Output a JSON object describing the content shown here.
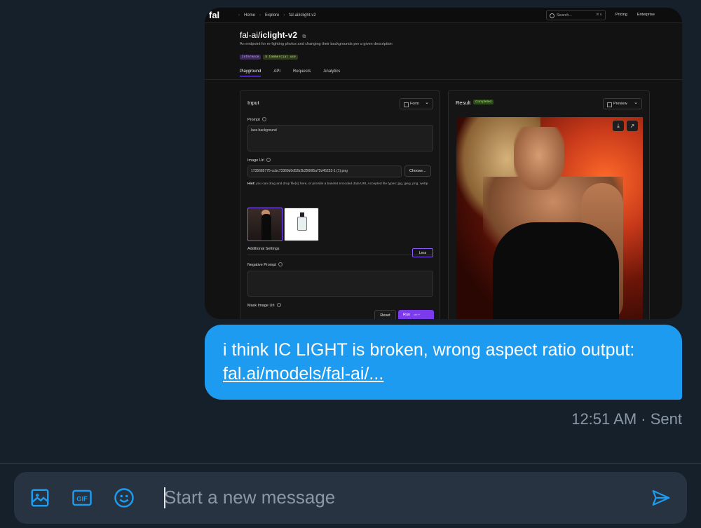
{
  "screenshot": {
    "topbar": {
      "logo": "fal",
      "crumbs": [
        "Home",
        "Explore",
        "fal-ai/iclight-v2"
      ],
      "search_placeholder": "Search...",
      "search_kbd": "⌘ K",
      "nav_right": [
        "Pricing",
        "Enterprise"
      ]
    },
    "title_prefix": "fal-ai/",
    "title_name": "iclight-v2",
    "subtitle": "An endpoint for re-lighting photos and changing their backgrounds per a given description",
    "tags": [
      "Inference",
      "$ Commercial use"
    ],
    "tabs": [
      "Playground",
      "API",
      "Requests",
      "Analytics"
    ],
    "input_panel": {
      "heading": "Input",
      "form_button": "Form",
      "prompt_label": "Prompt",
      "prompt_value": "lava background",
      "image_url_label": "Image Url",
      "image_url_value": "1735685775-ccbc73369d0d52b2b2566f5a72d45233-1 (1).png",
      "choose_button": "Choose...",
      "hint_bold": "Hint:",
      "hint_text": "you can drag and drop file(s) here, or provide a base64 encoded data URL Accepted file types: jpg, jpeg, png, webp",
      "additional_settings": "Additional Settings",
      "less_button": "Less",
      "negative_prompt_label": "Negative Prompt",
      "mask_image_label": "Mask Image Url",
      "reset_button": "Reset",
      "run_button": "Run",
      "run_kbd": "ctrl ↵"
    },
    "result_panel": {
      "heading": "Result",
      "status_badge": "Completed",
      "preview_button": "Preview"
    }
  },
  "message": {
    "text": "i think IC LIGHT is broken, wrong aspect ratio output:",
    "link": "fal.ai/models/fal-ai/...",
    "timestamp": "12:51 AM",
    "status": "Sent",
    "bubble_color": "#1d9bf0"
  },
  "composer": {
    "placeholder": "Start a new message",
    "icons": [
      "image-icon",
      "gif-icon",
      "emoji-icon",
      "send-icon"
    ],
    "accent": "#1d9bf0"
  }
}
